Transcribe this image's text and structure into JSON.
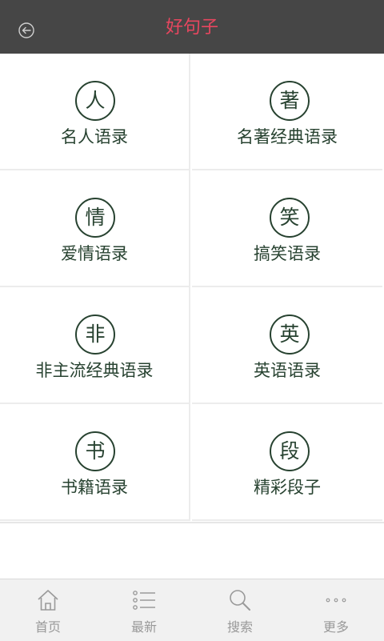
{
  "header": {
    "title": "好句子",
    "title_color": "#e8465f",
    "bg_color": "#464646",
    "back_icon": "back-arrow-icon"
  },
  "categories": [
    {
      "icon_char": "人",
      "label": "名人语录"
    },
    {
      "icon_char": "著",
      "label": "名著经典语录"
    },
    {
      "icon_char": "情",
      "label": "爱情语录"
    },
    {
      "icon_char": "笑",
      "label": "搞笑语录"
    },
    {
      "icon_char": "非",
      "label": "非主流经典语录"
    },
    {
      "icon_char": "英",
      "label": "英语语录"
    },
    {
      "icon_char": "书",
      "label": "书籍语录"
    },
    {
      "icon_char": "段",
      "label": "精彩段子"
    }
  ],
  "category_color": "#274230",
  "tabs": [
    {
      "label": "首页",
      "icon": "home-icon"
    },
    {
      "label": "最新",
      "icon": "list-icon"
    },
    {
      "label": "搜索",
      "icon": "search-icon"
    },
    {
      "label": "更多",
      "icon": "more-dots-icon"
    }
  ]
}
